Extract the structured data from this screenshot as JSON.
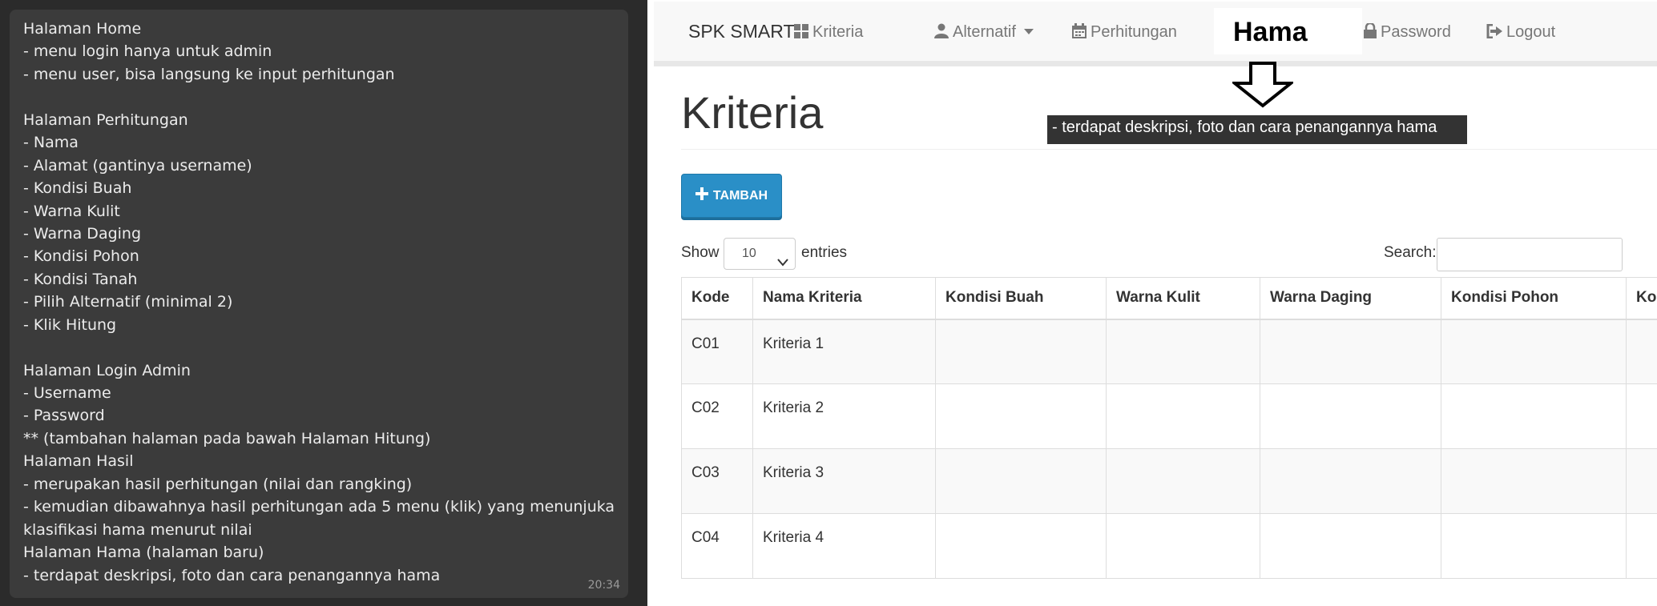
{
  "chat": {
    "lines": [
      "Halaman Home",
      "- menu login hanya untuk admin",
      "- menu user, bisa langsung ke input perhitungan",
      "",
      "Halaman Perhitungan",
      "- Nama",
      "- Alamat (gantinya username)",
      "- Kondisi Buah",
      "- Warna Kulit",
      "- Warna Daging",
      "- Kondisi Pohon",
      "- Kondisi Tanah",
      "- Pilih Alternatif (minimal 2)",
      "- Klik Hitung",
      "",
      "Halaman Login Admin",
      "- Username",
      "- Password",
      "** (tambahan halaman pada bawah Halaman Hitung)",
      "Halaman Hasil",
      "- merupakan hasil perhitungan (nilai dan rangking)",
      "- kemudian dibawahnya hasil perhitungan ada 5 menu (klik) yang menunjukan",
      "klasifikasi hama menurut nilai",
      "Halaman Hama (halaman baru)",
      "- terdapat deskripsi, foto dan cara penangannya hama"
    ],
    "time": "20:34"
  },
  "navbar": {
    "brand": "SPK SMART",
    "items": {
      "kriteria": "Kriteria",
      "alternatif": "Alternatif",
      "perhitungan": "Perhitungan",
      "password": "Password",
      "logout": "Logout"
    },
    "hama_label": "Hama"
  },
  "annotation": {
    "text": "- terdapat deskripsi, foto dan cara penangannya hama"
  },
  "page": {
    "title": "Kriteria",
    "add_button": "TAMBAH"
  },
  "table_controls": {
    "show_label": "Show",
    "entries_value": "10",
    "entries_label": "entries",
    "search_label": "Search:"
  },
  "table": {
    "headers": [
      "Kode",
      "Nama Kriteria",
      "Kondisi Buah",
      "Warna Kulit",
      "Warna Daging",
      "Kondisi Pohon",
      "Ko"
    ],
    "rows": [
      [
        "C01",
        "Kriteria 1",
        "",
        "",
        "",
        "",
        ""
      ],
      [
        "C02",
        "Kriteria 2",
        "",
        "",
        "",
        "",
        ""
      ],
      [
        "C03",
        "Kriteria 3",
        "",
        "",
        "",
        "",
        ""
      ],
      [
        "C04",
        "Kriteria 4",
        "",
        "",
        "",
        "",
        ""
      ]
    ]
  },
  "colors": {
    "chat_bg": "#3b3b3b",
    "navbar_bg": "#f8f8f8",
    "primary_button": "#2a8fc7",
    "annotation_bg": "#333333"
  }
}
